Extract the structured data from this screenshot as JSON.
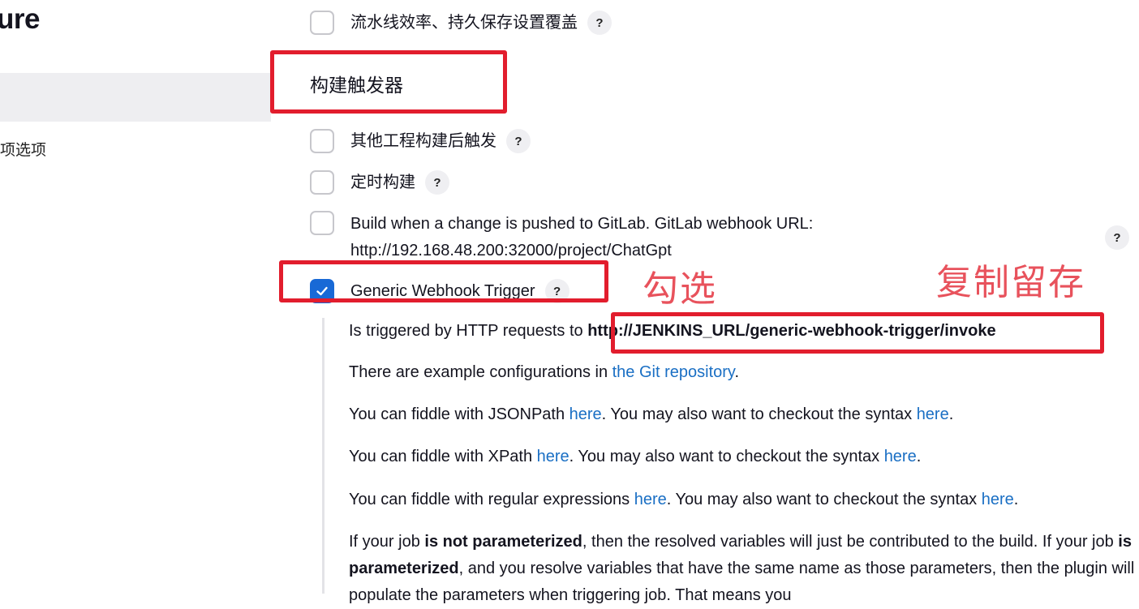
{
  "sidebar": {
    "title_fragment": "ure",
    "item_fragment": "项选项"
  },
  "options": {
    "pipeline_durability": "流水线效率、持久保存设置覆盖",
    "section_title": "构建触发器",
    "after_other_projects": "其他工程构建后触发",
    "periodic_build": "定时构建",
    "gitlab_line1": "Build when a change is pushed to GitLab. GitLab webhook URL:",
    "gitlab_line2": "http://192.168.48.200:32000/project/ChatGpt",
    "generic_webhook": "Generic Webhook Trigger",
    "help_mark": "?"
  },
  "help_text": {
    "p1_prefix": "Is triggered by HTTP requests to ",
    "p1_url": "http://JENKINS_URL/generic-webhook-trigger/invoke",
    "p2_prefix": "There are example configurations in ",
    "p2_link": "the Git repository",
    "p2_suffix": ".",
    "p3_prefix": "You can fiddle with JSONPath ",
    "p4_prefix": "You can fiddle with XPath ",
    "p5_prefix": "You can fiddle with regular expressions ",
    "here": "here",
    "syntax_mid": ". You may also want to checkout the syntax ",
    "period": ".",
    "p6_a": "If your job ",
    "p6_b": "is not parameterized",
    "p6_c": ", then the resolved variables will just be contributed to the build. If your job ",
    "p6_d": "is parameterized",
    "p6_e": ", and you resolve variables that have the same name as those parameters, then the plugin will populate the parameters when triggering job. That means you"
  },
  "annotations": {
    "check_note": "勾选",
    "copy_note": "复制留存"
  },
  "colors": {
    "annotation_red": "#e21d2d",
    "link_blue": "#1a6fc4",
    "checkbox_blue": "#1869d6"
  }
}
